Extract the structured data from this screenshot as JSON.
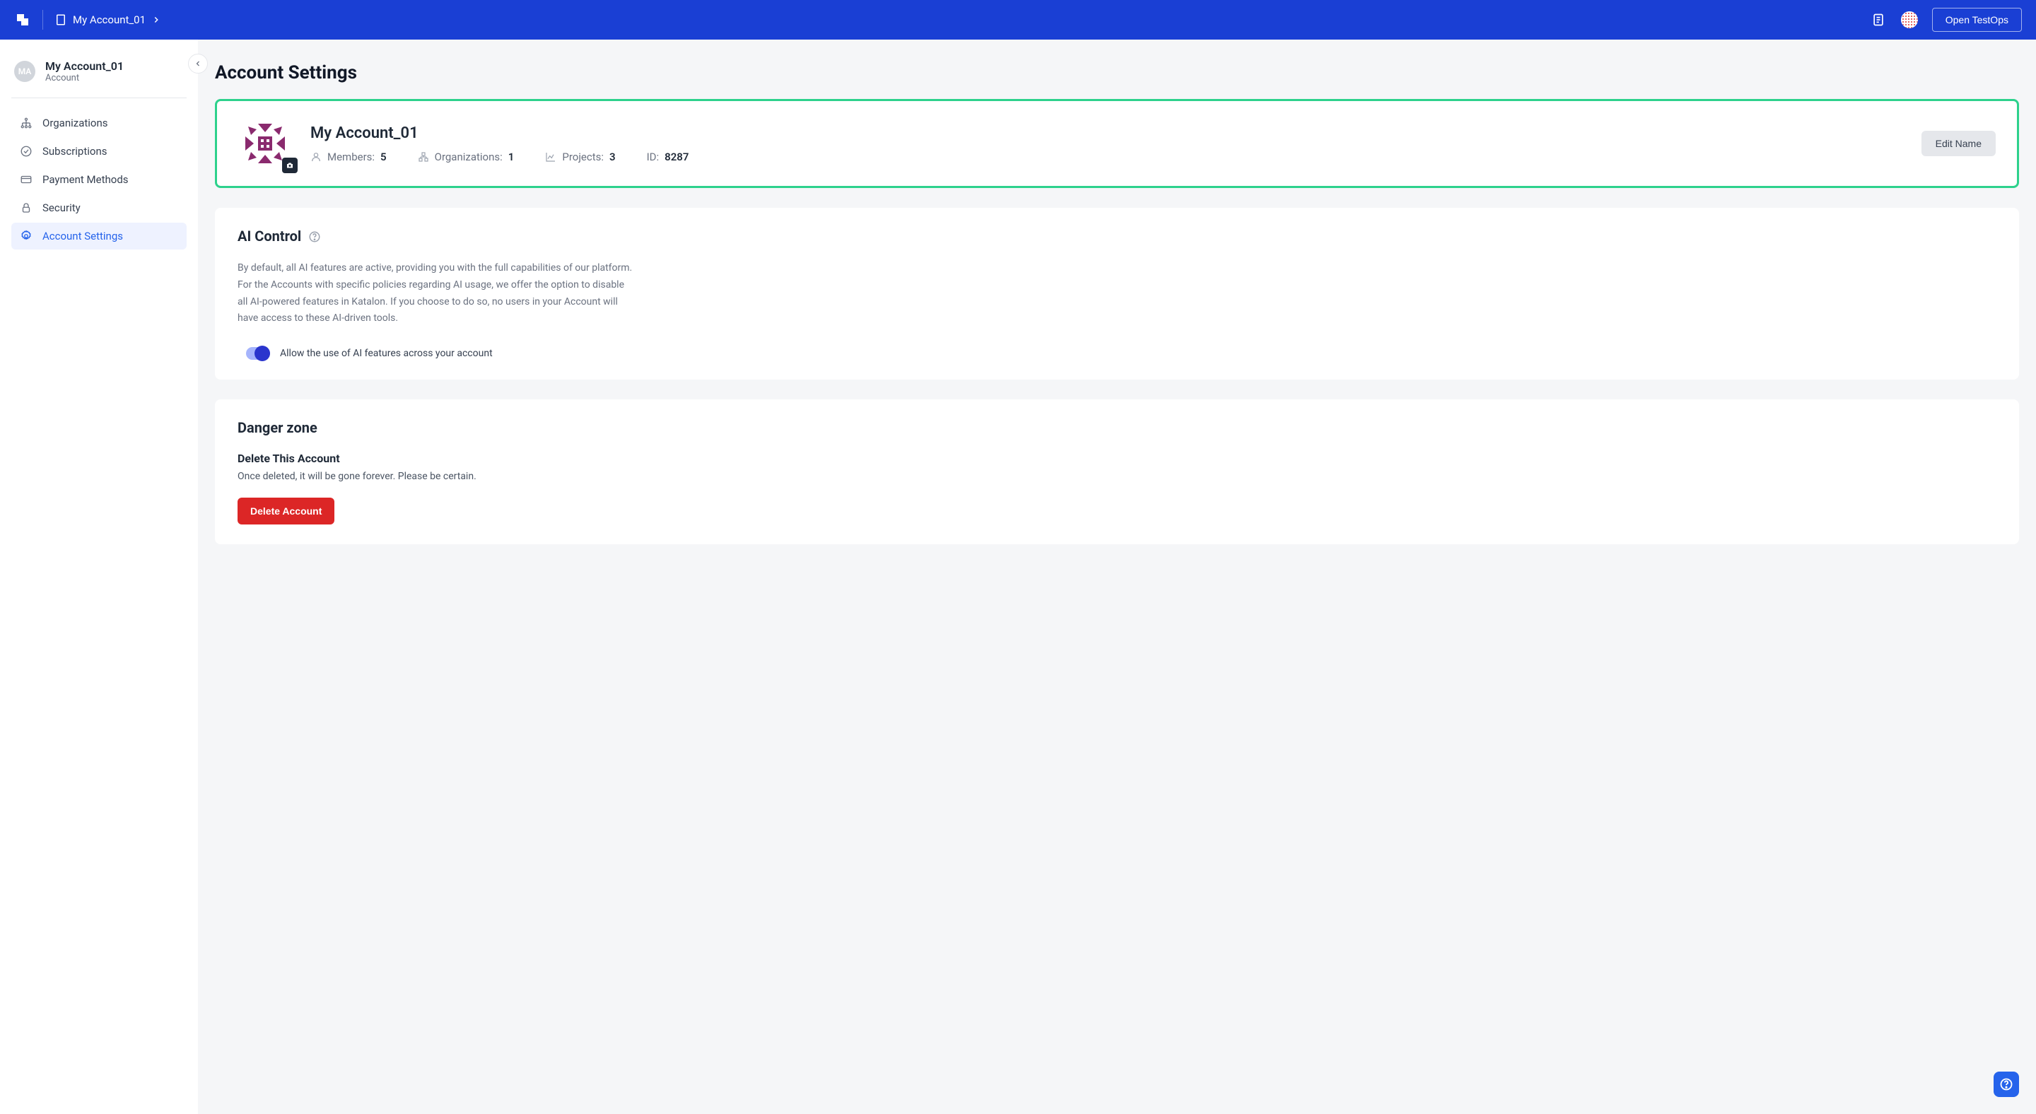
{
  "header": {
    "breadcrumb_text": "My Account_01",
    "open_testops_label": "Open TestOps"
  },
  "sidebar": {
    "avatar_initials": "MA",
    "title": "My Account_01",
    "subtitle": "Account",
    "items": [
      {
        "label": "Organizations"
      },
      {
        "label": "Subscriptions"
      },
      {
        "label": "Payment Methods"
      },
      {
        "label": "Security"
      },
      {
        "label": "Account Settings"
      }
    ]
  },
  "page": {
    "title": "Account Settings"
  },
  "account_card": {
    "name": "My Account_01",
    "members_label": "Members:",
    "members_value": "5",
    "orgs_label": "Organizations:",
    "orgs_value": "1",
    "projects_label": "Projects:",
    "projects_value": "3",
    "id_label": "ID:",
    "id_value": "8287",
    "edit_name_label": "Edit Name"
  },
  "ai_control": {
    "title": "AI Control",
    "description": "By default, all AI features are active, providing you with the full capabilities of our platform. For the Accounts with specific policies regarding AI usage, we offer the option to disable all AI-powered features in Katalon. If you choose to do so, no users in your Account will have access to these AI-driven tools.",
    "toggle_label": "Allow the use of AI features across your account"
  },
  "danger_zone": {
    "title": "Danger zone",
    "subtitle": "Delete This Account",
    "description": "Once deleted, it will be gone forever. Please be certain.",
    "delete_label": "Delete Account"
  }
}
